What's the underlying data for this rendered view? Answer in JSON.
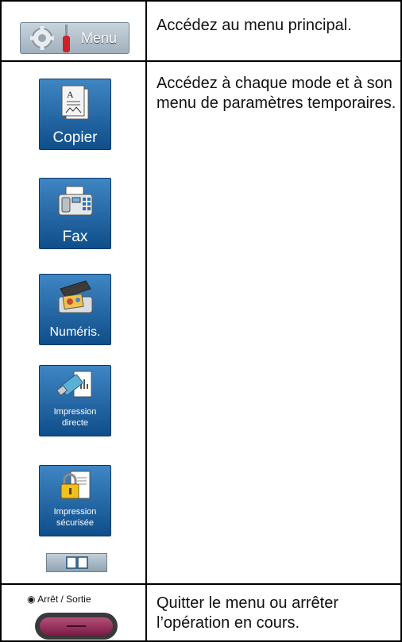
{
  "rows": [
    {
      "button_label": "Menu",
      "description": "Accédez au menu principal."
    },
    {
      "description": "Accédez à chaque mode et à son menu de paramètres temporaires.",
      "modes": [
        {
          "label": "Copier",
          "icon": "copier-icon"
        },
        {
          "label": "Fax",
          "icon": "fax-icon"
        },
        {
          "label": "Numéris.",
          "icon": "scanner-icon"
        },
        {
          "label_line1": "Impression",
          "label_line2": "directe",
          "icon": "usb-print-icon"
        },
        {
          "label_line1": "Impression",
          "label_line2": "sécurisée",
          "icon": "lock-print-icon"
        }
      ],
      "book_icon": "book-icon"
    },
    {
      "button_label": "Arrêt / Sortie",
      "description": "Quitter le menu ou arrêter l’opération en cours."
    }
  ],
  "colors": {
    "mode_button": "#1f66a8",
    "stop_button": "#9a2f5d",
    "border": "#000000"
  }
}
